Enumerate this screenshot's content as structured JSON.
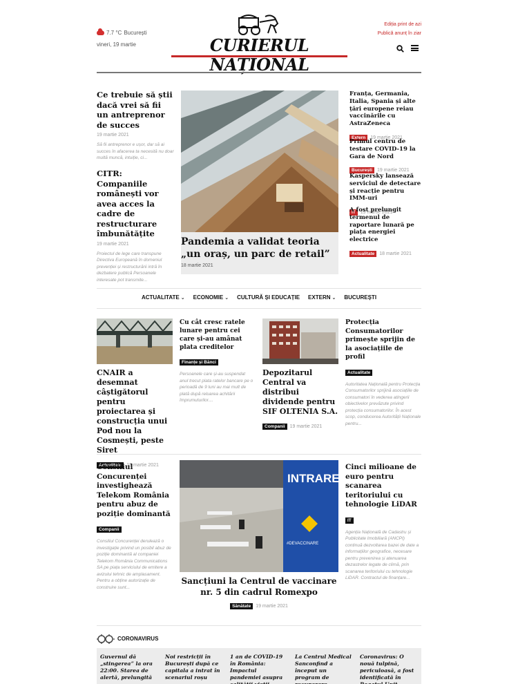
{
  "header": {
    "weather_temp": "7.7 °C",
    "weather_city": "București",
    "date": "vineri, 19 martie",
    "logo": "CURIERUL NAȚIONAL",
    "link_print": "Ediția print de azi",
    "link_ad": "Publică anunț în ziar"
  },
  "left_col": [
    {
      "title": "Ce trebuie să știi dacă vrei să fii un antreprenor de succes",
      "date": "19 martie 2021",
      "excerpt": "Să fii antreprenor e ușor, dar să ai succes în afacerea ta necesită nu doar multă muncă, intuiție, ci..."
    },
    {
      "title": "CITR: Companiile românești vor avea acces la cadre de restructurare îmbunătățite",
      "date": "19 martie 2021",
      "excerpt": "Proiectul de lege care transpune Directiva Europeană în domeniul prevenției și restructurării intră în dezbatere publică Persoanele interesate pot transmite..."
    }
  ],
  "hero": {
    "title": "Pandemia a validat teoria „un oraș, un parc de retail”",
    "date": "18 martie 2021"
  },
  "right_col": [
    {
      "title": "Franța, Germania, Italia, Spania și alte țări europene reiau vaccinările cu AstraZeneca",
      "tag": "Extern",
      "date": "19 martie 2021"
    },
    {
      "title": "Primul centru de testare COVID-19 la Gara de Nord",
      "tag": "București",
      "date": "19 martie 2021"
    },
    {
      "title": "Kaspersky lansează serviciul de detectare și reacție pentru IMM-uri",
      "tag": "IT",
      "date": "19 martie 2021"
    },
    {
      "title": "A fost prelungit termenul de raportare lunară pe piața energiei electrice",
      "tag": "Actualitate",
      "date": "18 martie 2021"
    }
  ],
  "nav": [
    "ACTUALITATE",
    "ECONOMIE",
    "CULTURĂ ȘI EDUCAȚIE",
    "EXTERN",
    "BUCUREȘTI"
  ],
  "row2": {
    "a": {
      "title": "CNAIR a desemnat câștigătorul pentru proiectarea și construcția unui Pod nou la Cosmești, peste Siret",
      "tag": "Actualitate",
      "date": "19 martie 2021"
    },
    "b": {
      "title": "Cu cât cresc ratele lunare pentru cei care și-au amânat plata creditelor",
      "tag": "Finanțe și Bănci",
      "excerpt": "Persoanele care și-au suspendat anul trecut plata ratelor bancare pe o perioadă de 9 luni au mai mult de plată după reluarea achitării împrumuturilor...."
    },
    "c": {
      "title": "Depozitarul Central va distribui dividende pentru SIF OLTENIA S.A.",
      "tag": "Companii",
      "date": "19 martie 2021"
    },
    "d": {
      "title": "Protecția Consumatorilor primește sprijin de la asociațiile de profil",
      "tag": "Actualitate",
      "excerpt": "Autoritatea Națională pentru Protecția Consumatorilor sprijină asociațiile de consumatori în vederea atingerii obiectivelor prevăzute privind protecția consumatorilor. În acest scop, conducerea Autorității Naționale pentru..."
    }
  },
  "row3": {
    "a": {
      "title": "Consiliul Concurenței investighează Telekom România pentru abuz de poziție dominantă",
      "tag": "Companii",
      "excerpt": "Consiliul Concurenței derulează o investigație privind un posibil abuz de poziție dominantă al companiei Telekom România Communications SA pe piața serviciului de emitere a avizului tehnic de amplasament. Pentru a obține autorizație de construire sunt..."
    },
    "hero": {
      "title": "Sancțiuni la Centrul de vaccinare nr. 5 din cadrul Romexpo",
      "tag": "Sănătate",
      "date": "19 martie 2021",
      "sign": "INTRARE",
      "banner": "#DEVACCINARE"
    },
    "d": {
      "title": "Cinci milioane de euro pentru scanarea teritoriului cu tehnologie LiDAR",
      "tag": "IT",
      "excerpt": "Agenția Națională de Cadastru și Publicitate Imobiliară (ANCPI) continuă dezvoltarea bazei de date a informațiilor geografice, necesare pentru prevenirea și atenuarea dezastrelor legate de climă, prin scanarea teritoriului cu tehnologie LiDAR. Contractul de finanțare..."
    }
  },
  "corona": {
    "label": "CORONAVIRUS",
    "items": [
      "Guvernul dă „stingerea” la ora 22:00. Starea de alertă, prelungită",
      "Noi restricții în București după ce capitala a intrat în scenariul roșu",
      "1 an de COVID-19 în România: Impactul pandemiei asupra calității vieții",
      "La Centrul Medical Sanconfind a început un program de recuperare medicala",
      "Coronavirus: O nouă tulpină, periculoasă, a fost identificată în Regatul Unit"
    ]
  },
  "colors": {
    "accent": "#c62828",
    "dark": "#111111",
    "card": "#ececec"
  }
}
